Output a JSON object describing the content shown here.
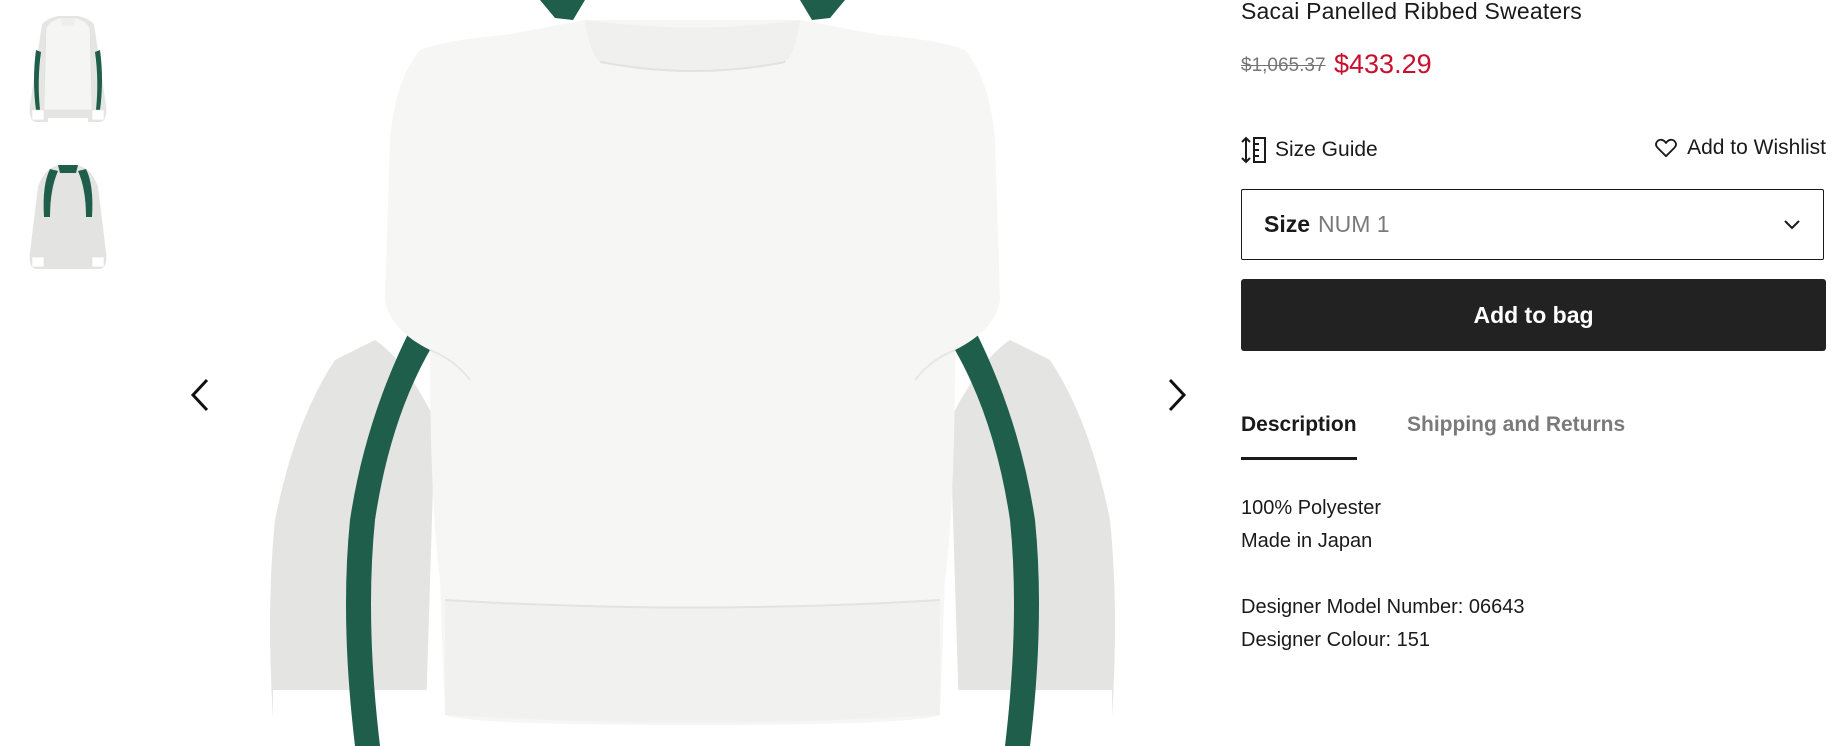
{
  "product": {
    "title": "Sacai Panelled Ribbed Sweaters",
    "price_original": "$1,065.37",
    "price_sale": "$433.29"
  },
  "actions": {
    "size_guide_label": "Size Guide",
    "wishlist_label": "Add to Wishlist",
    "size_label": "Size",
    "size_value": "NUM 1",
    "add_to_bag_label": "Add to bag"
  },
  "tabs": [
    {
      "label": "Description",
      "active": true
    },
    {
      "label": "Shipping and Returns",
      "active": false
    }
  ],
  "description": {
    "lines": [
      "100% Polyester",
      "Made in Japan"
    ],
    "model_number": "Designer Model Number: 06643",
    "colour": "Designer Colour: 151"
  },
  "gallery": {
    "thumbnails": [
      "sweater-front-thumbnail",
      "sweater-back-thumbnail"
    ],
    "icons": [
      "chevron-left-icon",
      "chevron-right-icon"
    ]
  },
  "colors": {
    "sale_price": "#c8102e",
    "button_bg": "#222222",
    "sweater_green": "#1e5e4a",
    "sweater_grey": "#e3e3e1"
  }
}
